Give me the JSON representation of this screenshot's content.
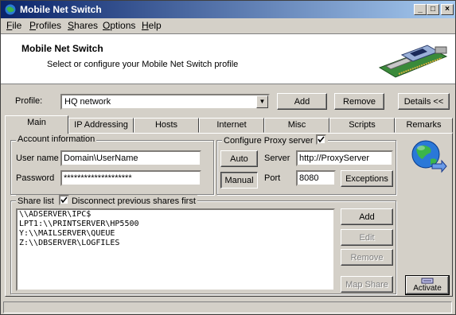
{
  "window": {
    "title": "Mobile Net Switch"
  },
  "menu": [
    {
      "label": "File",
      "key": "F",
      "rest": "ile"
    },
    {
      "label": "Profiles",
      "key": "P",
      "rest": "rofiles"
    },
    {
      "label": "Shares",
      "key": "S",
      "rest": "hares"
    },
    {
      "label": "Options",
      "key": "O",
      "rest": "ptions"
    },
    {
      "label": "Help",
      "key": "H",
      "rest": "elp"
    }
  ],
  "header": {
    "title": "Mobile Net Switch",
    "subtitle": "Select or configure your Mobile Net Switch profile"
  },
  "profile": {
    "label": "Profile:",
    "value": "HQ network",
    "add": "Add",
    "remove": "Remove",
    "details": "Details <<"
  },
  "tabs": [
    "Main",
    "IP Addressing",
    "Hosts",
    "Internet",
    "Misc",
    "Scripts",
    "Remarks"
  ],
  "account": {
    "legend": "Account information",
    "username_label": "User name",
    "username_value": "Domain\\UserName",
    "password_label": "Password",
    "password_value": "********************"
  },
  "proxy": {
    "legend": "Configure Proxy server",
    "checked": true,
    "auto": "Auto",
    "manual": "Manual",
    "server_label": "Server",
    "server_value": "http://ProxyServer",
    "port_label": "Port",
    "port_value": "8080",
    "exceptions": "Exceptions"
  },
  "shares": {
    "legend": "Share list",
    "disconnect_label": "Disconnect previous shares first",
    "disconnect_checked": true,
    "items": [
      "\\\\ADSERVER\\IPC$",
      "LPT1:\\\\PRINTSERVER\\HP5500",
      "Y:\\\\MAILSERVER\\QUEUE",
      "Z:\\\\DBSERVER\\LOGFILES"
    ],
    "add": "Add",
    "edit": "Edit",
    "remove": "Remove",
    "map_share": "Map Share"
  },
  "activate": "Activate",
  "colors": {
    "titlebar_start": "#0a246a",
    "titlebar_end": "#a6caf0",
    "face": "#d4d0c8"
  }
}
